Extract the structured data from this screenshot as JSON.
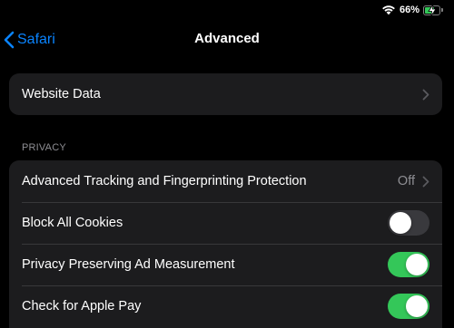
{
  "status_bar": {
    "battery_percent": "66%",
    "battery_level": 0.66,
    "wifi_icon": "wifi-icon",
    "battery_icon": "battery-charging-icon"
  },
  "nav": {
    "back_label": "Safari",
    "title": "Advanced"
  },
  "website_data": {
    "label": "Website Data"
  },
  "privacy": {
    "header": "PRIVACY",
    "items": [
      {
        "label": "Advanced Tracking and Fingerprinting Protection",
        "value": "Off",
        "kind": "disclosure"
      },
      {
        "label": "Block All Cookies",
        "kind": "toggle",
        "on": false
      },
      {
        "label": "Privacy Preserving Ad Measurement",
        "kind": "toggle",
        "on": true
      },
      {
        "label": "Check for Apple Pay",
        "kind": "toggle",
        "on": true
      }
    ]
  },
  "colors": {
    "accent": "#0a84ff",
    "toggle_on": "#34c759",
    "toggle_off": "#39393d",
    "cell_background": "#1c1c1e",
    "secondary_text": "#8e8e93"
  }
}
